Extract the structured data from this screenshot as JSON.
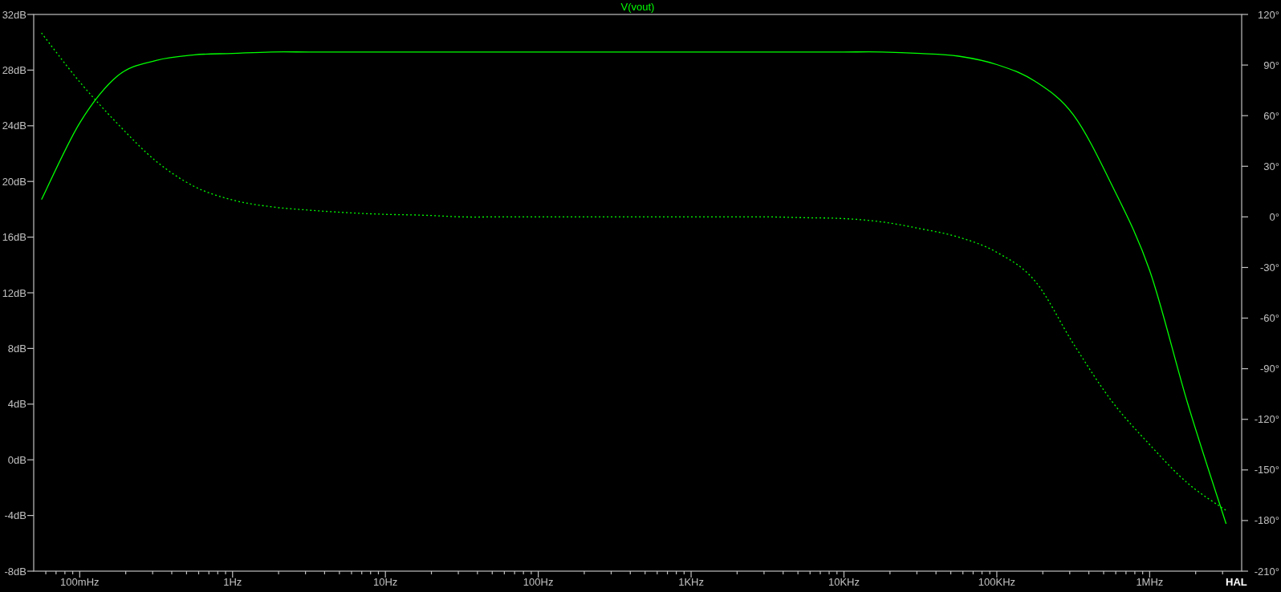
{
  "chart_data": {
    "type": "line",
    "title": "V(vout)",
    "categories": [
      null,
      "100mHz",
      null,
      null,
      null,
      "1Hz",
      null,
      null,
      null,
      "10Hz",
      null,
      null,
      null,
      "100Hz",
      null,
      null,
      null,
      "1KHz",
      null,
      null,
      null,
      "10KHz",
      null,
      null,
      null,
      "100KHz",
      null,
      null,
      null,
      "1MHz",
      null,
      null
    ],
    "series": [
      {
        "color": "#00ff00",
        "line_style": "solid",
        "values": [
          18.7,
          24.2,
          27.6,
          28.7,
          29.1,
          29.2,
          29.3,
          29.3,
          29.3,
          29.3,
          29.3,
          29.3,
          29.3,
          29.3,
          29.3,
          29.3,
          29.3,
          29.3,
          29.3,
          29.3,
          29.3,
          29.3,
          29.3,
          29.2,
          29.0,
          28.4,
          27.2,
          24.8,
          19.8,
          13.6,
          4.0,
          -4.6
        ]
      },
      {
        "color": "#00ff00",
        "axis": "y2",
        "line_style": "dashed",
        "values": [
          109,
          80,
          55,
          33,
          18,
          10,
          6,
          4,
          2.5,
          1.5,
          1,
          0,
          0,
          0,
          0,
          0,
          0,
          0,
          0,
          0,
          -0.5,
          -1,
          -3,
          -7,
          -12,
          -21,
          -38,
          -75,
          -109,
          -135,
          -158,
          -174
        ]
      }
    ],
    "ylim": [
      -8,
      32
    ],
    "y2lim": [
      -210,
      120
    ],
    "yticks": [
      {
        "value": 32,
        "label": "32dB"
      },
      {
        "value": 28,
        "label": "28dB"
      },
      {
        "value": 24,
        "label": "24dB"
      },
      {
        "value": 20,
        "label": "20dB"
      },
      {
        "value": 16,
        "label": "16dB"
      },
      {
        "value": 12,
        "label": "12dB"
      },
      {
        "value": 8,
        "label": "8dB"
      },
      {
        "value": 4,
        "label": "4dB"
      },
      {
        "value": 0,
        "label": "0dB"
      },
      {
        "value": -4,
        "label": "-4dB"
      },
      {
        "value": -8,
        "label": "-8dB"
      }
    ],
    "y2ticks": [
      {
        "value": 120,
        "label": "120°"
      },
      {
        "value": 90,
        "label": "90°"
      },
      {
        "value": 60,
        "label": "60°"
      },
      {
        "value": 30,
        "label": "30°"
      },
      {
        "value": 0,
        "label": "0°"
      },
      {
        "value": -30,
        "label": "-30°"
      },
      {
        "value": -60,
        "label": "-60°"
      },
      {
        "value": -90,
        "label": "-90°"
      },
      {
        "value": -120,
        "label": "-120°"
      },
      {
        "value": -150,
        "label": "-150°"
      },
      {
        "value": -180,
        "label": "-180°"
      },
      {
        "value": -210,
        "label": "-210°"
      }
    ]
  },
  "corner_label": "HAL"
}
